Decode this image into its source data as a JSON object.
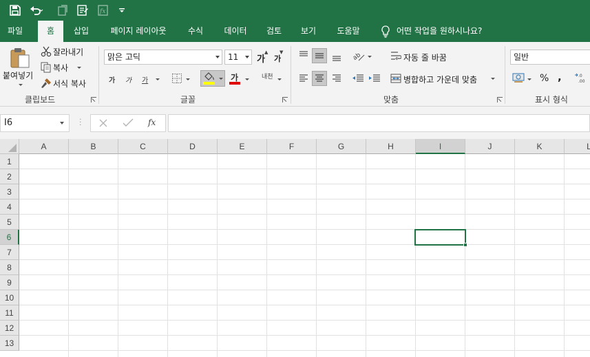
{
  "colors": {
    "accent": "#217346",
    "ribbon_bg": "#f3f3f3",
    "header_bg": "#e6e6e6",
    "gridline": "#e1e1e1"
  },
  "quick_access": {
    "icons": [
      "save-icon",
      "undo-icon",
      "redo-icon",
      "form-icon",
      "clear-format-icon",
      "customize-qat-icon"
    ]
  },
  "tabs": [
    "파일",
    "홈",
    "삽입",
    "페이지 레이아웃",
    "수식",
    "데이터",
    "검토",
    "보기",
    "도움말"
  ],
  "active_tab": "홈",
  "tell_me": "어떤 작업을 원하시나요?",
  "clipboard": {
    "paste": "붙여넣기",
    "cut": "잘라내기",
    "copy": "복사",
    "format_painter": "서식 복사",
    "group": "클립보드"
  },
  "font": {
    "name": "맑은 고딕",
    "size": "11",
    "grow": "가",
    "shrink": "가",
    "bold": "가",
    "italic": "가",
    "underline": "가",
    "font_color": "가",
    "phonetic": "내천",
    "group": "글꼴",
    "highlight_color": "#ffff00",
    "text_color": "#e00000"
  },
  "alignment": {
    "wrap_text": "자동 줄 바꿈",
    "merge_center": "병합하고 가운데 맞춤",
    "group": "맞춤"
  },
  "number": {
    "format": "일반",
    "percent": "%",
    "comma": ",",
    "group": "표시 형식"
  },
  "formula_bar": {
    "name_box": "I6",
    "fx": "fx",
    "content": ""
  },
  "sheet": {
    "columns": [
      "A",
      "B",
      "C",
      "D",
      "E",
      "F",
      "G",
      "H",
      "I",
      "J",
      "K",
      "L"
    ],
    "rows": [
      "1",
      "2",
      "3",
      "4",
      "5",
      "6",
      "7",
      "8",
      "9",
      "10",
      "11",
      "12",
      "13"
    ],
    "selected_cell": "I6",
    "selected_column": "I",
    "selected_row": "6"
  }
}
